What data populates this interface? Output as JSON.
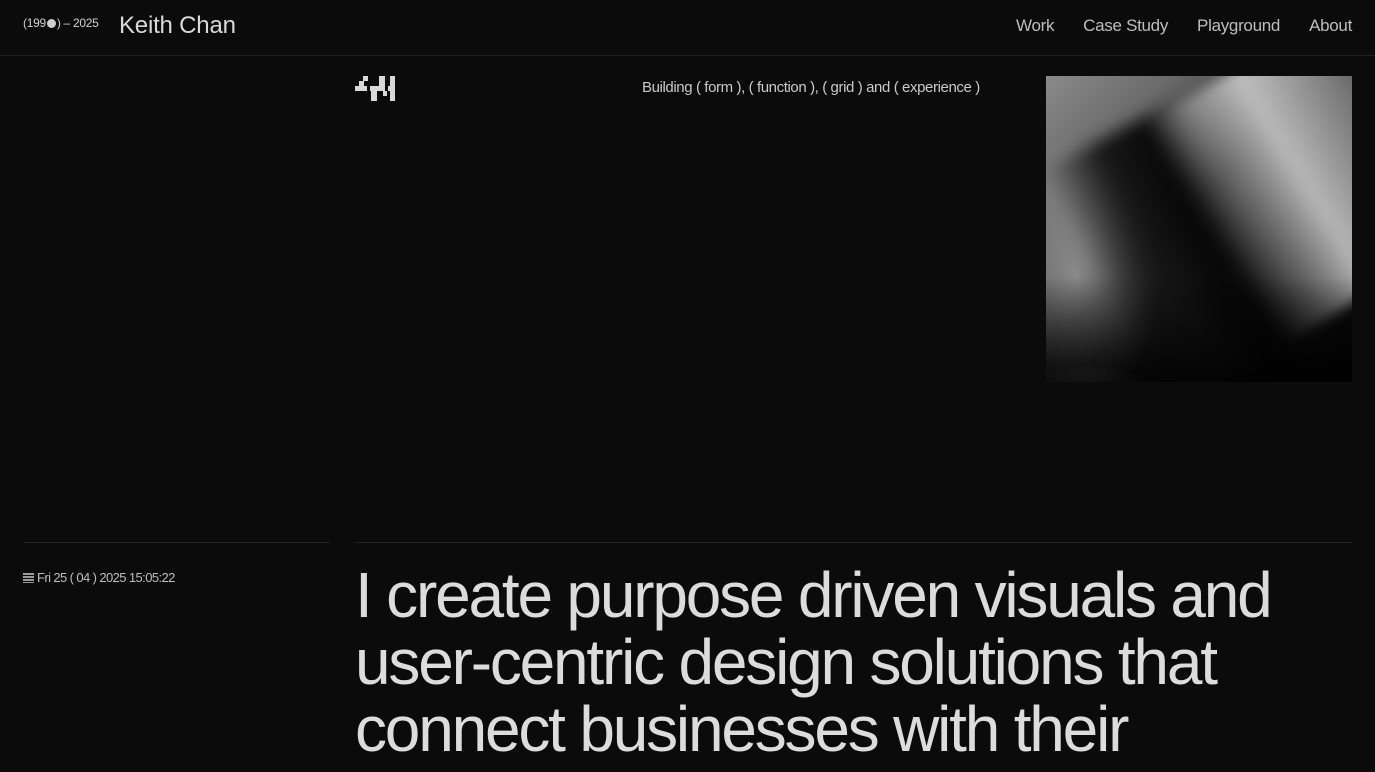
{
  "header": {
    "years_prefix": "(199",
    "years_suffix": ") – 2025",
    "name": "Keith Chan",
    "nav": [
      {
        "label": "Work"
      },
      {
        "label": "Case Study"
      },
      {
        "label": "Playground"
      },
      {
        "label": "About"
      }
    ]
  },
  "hero": {
    "logo_icon": "pixel-mark-icon",
    "tagline": "Building ( form ), ( function ), ( grid ) and ( experience )",
    "image_icon": "abstract-blurred-photo"
  },
  "footer_meta": {
    "clock_icon": "striped-flag-icon",
    "datetime": "Fri 25 ( 04 ) 2025 15:05:22"
  },
  "intro": {
    "headline": "I create purpose driven visuals and user-centric design solutions that connect businesses with their"
  },
  "colors": {
    "background": "#0b0b0c",
    "text": "#dcdcdc",
    "muted": "#bdbdbd",
    "divider": "#222224"
  }
}
